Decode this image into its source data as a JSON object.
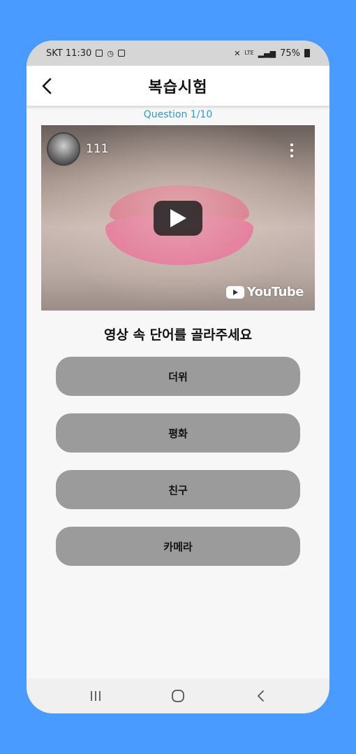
{
  "status_bar": {
    "carrier_time": "SKT 11:30",
    "battery": "75%",
    "signal": "LTE"
  },
  "app_bar": {
    "title": "복습시험",
    "back_icon": "chevron-left-icon"
  },
  "quiz": {
    "question_label": "Question 1/10",
    "prompt": "영상 속 단어를 골라주세요",
    "options": [
      "더위",
      "평화",
      "친구",
      "카메라"
    ]
  },
  "video": {
    "channel_name": "111",
    "logo_text": "YouTube",
    "play_icon": "play-icon",
    "more_icon": "more-vertical-icon"
  },
  "nav_bar": {
    "recents_icon": "recents-icon",
    "home_icon": "home-icon",
    "back_icon": "back-icon"
  },
  "colors": {
    "background": "#4a9bff",
    "accent": "#2a9bd6",
    "option_bg": "#9b9b9b"
  }
}
